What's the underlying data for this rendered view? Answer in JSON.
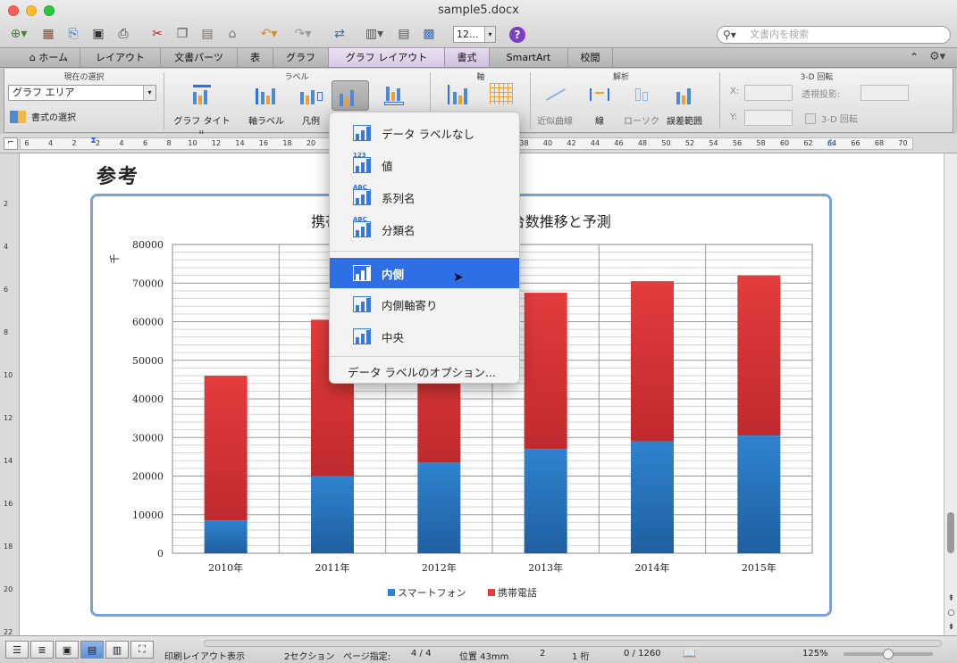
{
  "window": {
    "title": "sample5.docx"
  },
  "toolbar": {
    "font_size": "12...",
    "search_placeholder": "文書内を検索"
  },
  "tabs": [
    "ホーム",
    "レイアウト",
    "文書パーツ",
    "表",
    "グラフ",
    "グラフ レイアウト",
    "書式",
    "SmartArt",
    "校閲"
  ],
  "ribbon": {
    "current_selection_title": "現在の選択",
    "selection_value": "グラフ エリア",
    "format_selection": "書式の選択",
    "labels_title": "ラベル",
    "axes_title": "軸",
    "analysis_title": "解析",
    "rotation_title": "3-D 回転",
    "chart_title": "グラフ タイトル",
    "axis_labels": "軸ラベル",
    "legend": "凡例",
    "trendline": "近似曲線",
    "lines": "線",
    "updown": "ローソク",
    "error_bars": "誤差範囲",
    "x_label": "X:",
    "y_label": "Y:",
    "perspective": "透視投影:",
    "rotation_3d": "3-D 回転"
  },
  "ruler": {
    "numbers": [
      "6",
      "4",
      "2",
      "2",
      "4",
      "6",
      "8",
      "10",
      "12",
      "14",
      "16",
      "18",
      "20",
      "22",
      "24",
      "26",
      "28",
      "30",
      "32",
      "34",
      "36",
      "38",
      "40",
      "42",
      "44",
      "46",
      "48",
      "50",
      "52",
      "54",
      "56",
      "58",
      "60",
      "62",
      "64",
      "66",
      "68",
      "70"
    ]
  },
  "vruler": {
    "numbers": [
      "2",
      "4",
      "6",
      "8",
      "10",
      "12",
      "14",
      "16",
      "18",
      "20",
      "22"
    ]
  },
  "document": {
    "heading": "参考"
  },
  "dropdown": {
    "items": [
      "データ ラベルなし",
      "値",
      "系列名",
      "分類名",
      "内側",
      "内側軸寄り",
      "中央"
    ],
    "badges": [
      "",
      "123",
      "ABC",
      "ABC"
    ],
    "options_label": "データ ラベルのオプション...",
    "selected": "内側"
  },
  "chart_data": {
    "type": "bar",
    "stacked": true,
    "title": "携帯電話・スマートフォン出荷台数推移と予測",
    "ylabel": "千",
    "categories": [
      "2010年",
      "2011年",
      "2012年",
      "2013年",
      "2014年",
      "2015年"
    ],
    "series": [
      {
        "name": "スマートフォン",
        "values": [
          8500,
          20000,
          23500,
          27000,
          29000,
          30500
        ],
        "color": "#2f83cf"
      },
      {
        "name": "携帯電話",
        "values": [
          37500,
          40500,
          39500,
          40500,
          41500,
          41500
        ],
        "color": "#e23c3e"
      }
    ],
    "ylim": [
      0,
      80000
    ],
    "yticks": [
      "0",
      "10000",
      "20000",
      "30000",
      "40000",
      "50000",
      "60000",
      "70000",
      "80000"
    ],
    "grid": true,
    "legend": "bottom"
  },
  "status": {
    "view": "印刷レイアウト表示",
    "sections": "2セクション",
    "page_label": "ページ指定:",
    "page": "4 / 4",
    "position": "位置 43mm",
    "line": "2",
    "column": "1 桁",
    "words": "0 / 1260",
    "zoom": "125%"
  }
}
